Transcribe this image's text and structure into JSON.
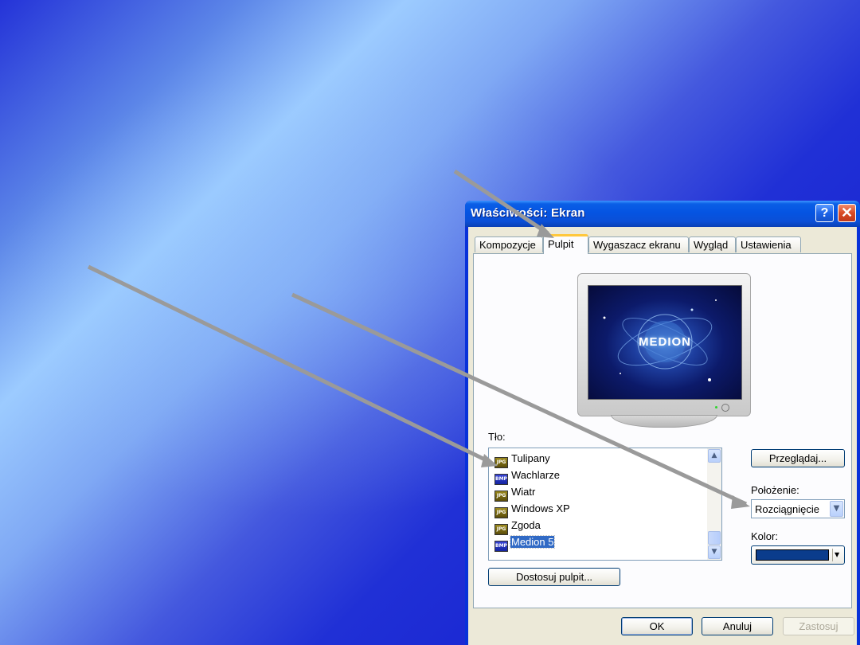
{
  "window": {
    "title": "Właściwości: Ekran",
    "help_label": "?",
    "close_label": "✕"
  },
  "tabs": [
    {
      "label": "Kompozycje",
      "active": false
    },
    {
      "label": "Pulpit",
      "active": true
    },
    {
      "label": "Wygaszacz ekranu",
      "active": false
    },
    {
      "label": "Wygląd",
      "active": false
    },
    {
      "label": "Ustawienia",
      "active": false
    }
  ],
  "preview": {
    "logo_text": "MEDION"
  },
  "background": {
    "label": "Tło:",
    "items": [
      {
        "icon": "jpg-file-icon",
        "badge": "JPG",
        "label": "Tulipany",
        "selected": false
      },
      {
        "icon": "bmp-file-icon",
        "badge": "BMP",
        "label": "Wachlarze",
        "selected": false
      },
      {
        "icon": "jpg-file-icon",
        "badge": "JPG",
        "label": "Wiatr",
        "selected": false
      },
      {
        "icon": "jpg-file-icon",
        "badge": "JPG",
        "label": "Windows XP",
        "selected": false
      },
      {
        "icon": "jpg-file-icon",
        "badge": "JPG",
        "label": "Zgoda",
        "selected": false
      },
      {
        "icon": "bmp-file-icon",
        "badge": "BMP",
        "label": "Medion 5",
        "selected": true
      }
    ],
    "browse_label": "Przeglądaj..."
  },
  "position": {
    "label": "Położenie:",
    "value": "Rozciągnięcie"
  },
  "color": {
    "label": "Kolor:",
    "value": "#0a3c8c"
  },
  "customize_label": "Dostosuj pulpit...",
  "buttons": {
    "ok": "OK",
    "cancel": "Anuluj",
    "apply": "Zastosuj"
  },
  "colors": {
    "selection": "#316ac5",
    "titlebar": "#0554e2",
    "tab_accent": "#ffc83c"
  }
}
